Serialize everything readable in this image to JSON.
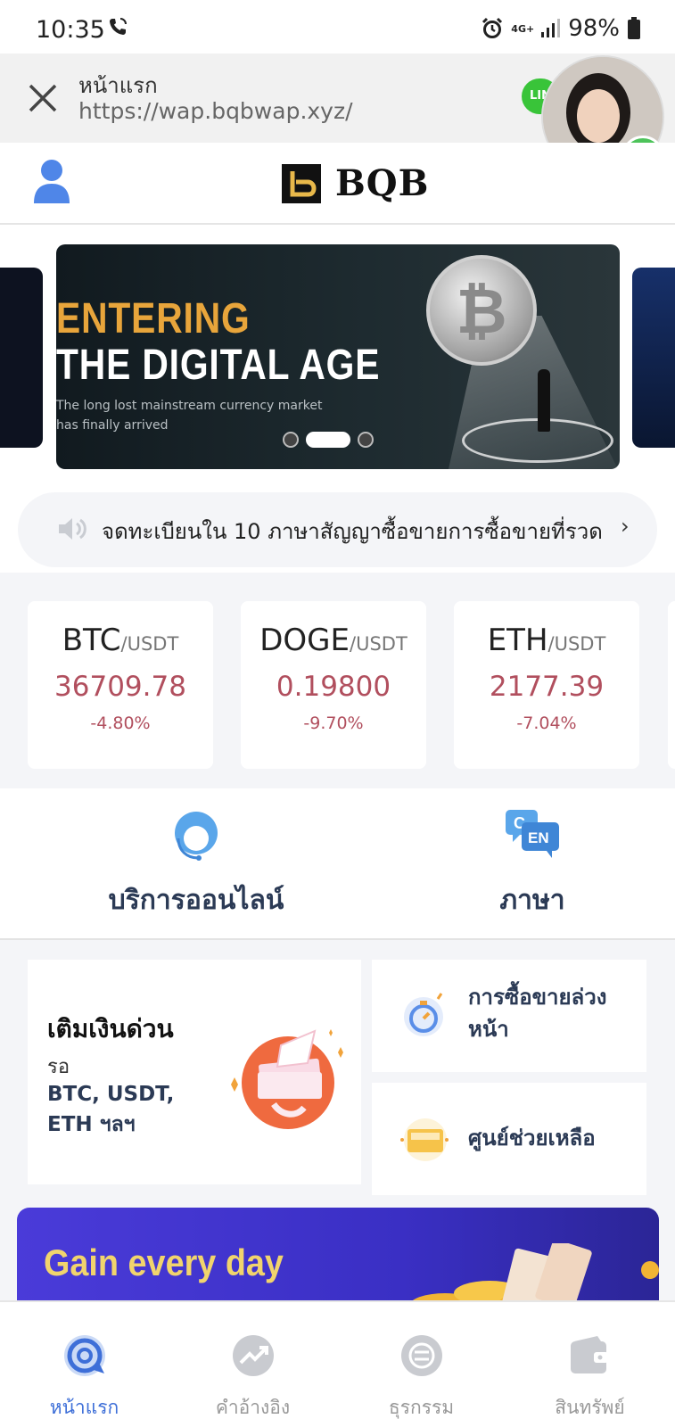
{
  "status_bar": {
    "time": "10:35",
    "network": "4G+",
    "battery": "98%"
  },
  "browser": {
    "title": "หน้าแรก",
    "url": "https://wap.bqbwap.xyz/",
    "bubble_badge": "LIN"
  },
  "header": {
    "logo_text": "BQB"
  },
  "banner": {
    "line1": "ENTERING",
    "line2": "THE DIGITAL AGE",
    "subtitle": "The long lost mainstream currency market has finally arrived",
    "active_slide": 1
  },
  "notice": {
    "text": "จดทะเบียนใน 10 ภาษาสัญญาซื้อขายการซื้อขายที่รวด",
    "chevron": "›"
  },
  "tickers": [
    {
      "base": "BTC",
      "quote": "/USDT",
      "price": "36709.78",
      "change": "-4.80%"
    },
    {
      "base": "DOGE",
      "quote": "/USDT",
      "price": "0.19800",
      "change": "-9.70%"
    },
    {
      "base": "ETH",
      "quote": "/USDT",
      "price": "2177.39",
      "change": "-7.04%"
    }
  ],
  "services": {
    "online_service": "บริการออนไลน์",
    "language": "ภาษา"
  },
  "features": {
    "quick_title": "เติมเงินด่วน",
    "quick_wait": "รอ",
    "quick_assets": "BTC, USDT, ETH ฯลฯ",
    "futures": "การซื้อขายล่วงหน้า",
    "help_center": "ศูนย์ช่วยเหลือ"
  },
  "promo": {
    "text": "Gain every day"
  },
  "tabbar": {
    "items": [
      {
        "label": "หน้าแรก",
        "icon": "home-icon",
        "active": true
      },
      {
        "label": "คำอ้างอิง",
        "icon": "quotes-chart-icon",
        "active": false
      },
      {
        "label": "ธุรกรรม",
        "icon": "trade-icon",
        "active": false
      },
      {
        "label": "สินทรัพย์",
        "icon": "wallet-icon",
        "active": false
      }
    ]
  },
  "colors": {
    "accent": "#3e6fd8",
    "price_down": "#b14f5e",
    "gold": "#e8a53b"
  }
}
